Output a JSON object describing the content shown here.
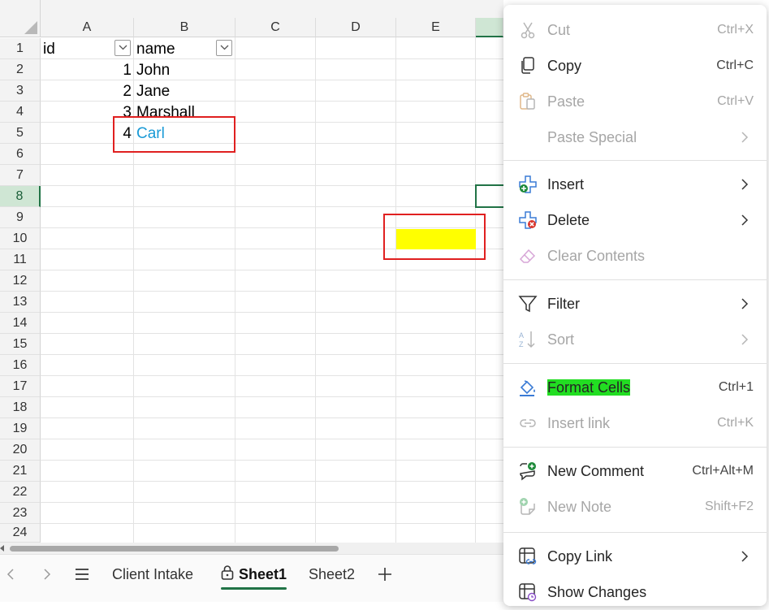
{
  "grid": {
    "columns": [
      "A",
      "B",
      "C",
      "D",
      "E"
    ],
    "rows": [
      "1",
      "2",
      "3",
      "4",
      "5",
      "6",
      "7",
      "8",
      "9",
      "10",
      "11",
      "12",
      "13",
      "14",
      "15",
      "16",
      "17",
      "18",
      "19",
      "20",
      "21",
      "22",
      "23",
      "24"
    ],
    "header_row": {
      "a1": "id",
      "b1": "name"
    },
    "data": [
      {
        "id": "1",
        "name": "John"
      },
      {
        "id": "2",
        "name": "Jane"
      },
      {
        "id": "3",
        "name": "Marshall"
      },
      {
        "id": "4",
        "name": "Carl"
      }
    ],
    "link_color": "#1a9ad6",
    "fill_color": "#ffff00",
    "accent": "#217346"
  },
  "sheet_tabs": {
    "tabs": [
      "Client Intake",
      "Sheet1",
      "Sheet2"
    ],
    "active": "Sheet1"
  },
  "context_menu": {
    "cut": {
      "label": "Cut",
      "shortcut": "Ctrl+X"
    },
    "copy": {
      "label": "Copy",
      "shortcut": "Ctrl+C"
    },
    "paste": {
      "label": "Paste",
      "shortcut": "Ctrl+V"
    },
    "paste_special": {
      "label": "Paste Special"
    },
    "insert": {
      "label": "Insert"
    },
    "delete": {
      "label": "Delete"
    },
    "clear": {
      "label": "Clear Contents"
    },
    "filter": {
      "label": "Filter"
    },
    "sort": {
      "label": "Sort"
    },
    "format_cells": {
      "label": "Format Cells",
      "shortcut": "Ctrl+1"
    },
    "insert_link": {
      "label": "Insert link",
      "shortcut": "Ctrl+K"
    },
    "new_comment": {
      "label": "New Comment",
      "shortcut": "Ctrl+Alt+M"
    },
    "new_note": {
      "label": "New Note",
      "shortcut": "Shift+F2"
    },
    "copy_link": {
      "label": "Copy Link"
    },
    "show_changes": {
      "label": "Show Changes"
    },
    "highlight_color": "#22dd22"
  }
}
